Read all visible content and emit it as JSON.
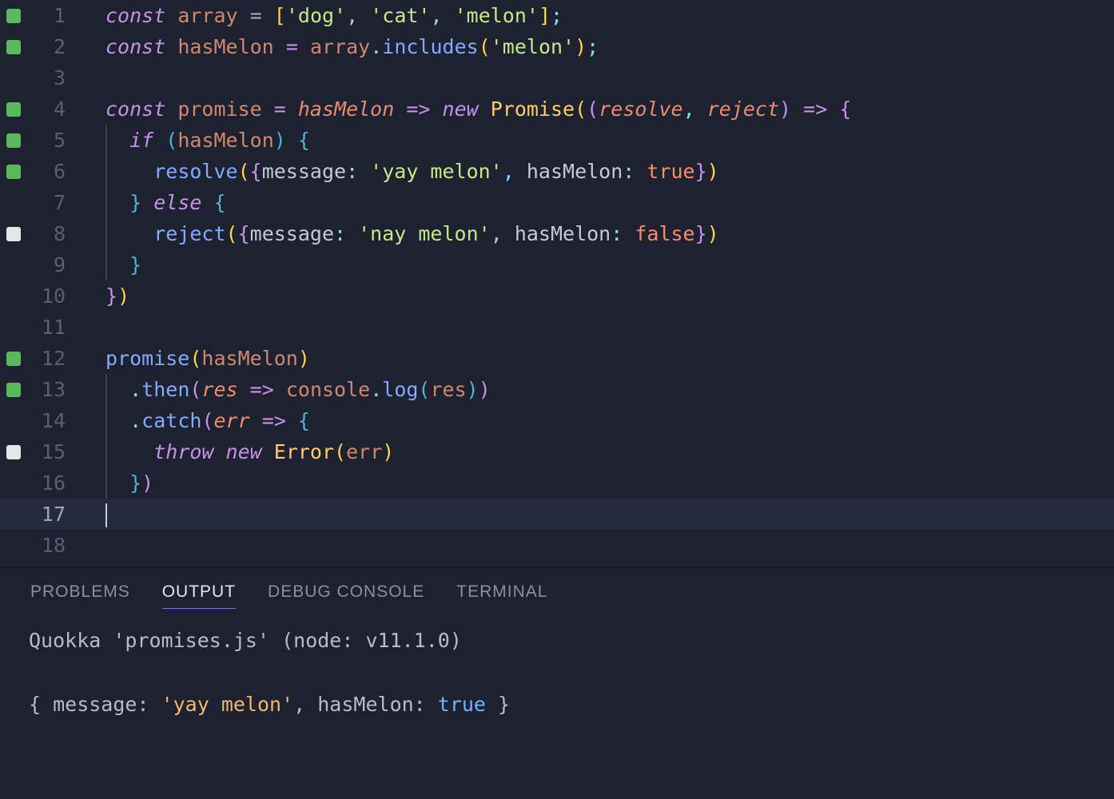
{
  "editor": {
    "lines": [
      {
        "n": 1,
        "mark": "green",
        "tokens": [
          [
            "kw",
            "const"
          ],
          [
            "def",
            " "
          ],
          [
            "var",
            "array"
          ],
          [
            "def",
            " "
          ],
          [
            "op",
            "="
          ],
          [
            "def",
            " "
          ],
          [
            "paren1",
            "["
          ],
          [
            "str",
            "'dog'"
          ],
          [
            "pun",
            ", "
          ],
          [
            "str",
            "'cat'"
          ],
          [
            "pun",
            ", "
          ],
          [
            "str",
            "'melon'"
          ],
          [
            "paren1",
            "]"
          ],
          [
            "pun",
            ";"
          ]
        ]
      },
      {
        "n": 2,
        "mark": "green",
        "tokens": [
          [
            "kw",
            "const"
          ],
          [
            "def",
            " "
          ],
          [
            "var",
            "hasMelon"
          ],
          [
            "def",
            " "
          ],
          [
            "op",
            "="
          ],
          [
            "def",
            " "
          ],
          [
            "var",
            "array"
          ],
          [
            "pun",
            "."
          ],
          [
            "fn",
            "includes"
          ],
          [
            "paren1",
            "("
          ],
          [
            "str",
            "'melon'"
          ],
          [
            "paren1",
            ")"
          ],
          [
            "pun",
            ";"
          ]
        ]
      },
      {
        "n": 3,
        "mark": "",
        "tokens": []
      },
      {
        "n": 4,
        "mark": "green",
        "tokens": [
          [
            "kw",
            "const"
          ],
          [
            "def",
            " "
          ],
          [
            "var",
            "promise"
          ],
          [
            "def",
            " "
          ],
          [
            "op",
            "="
          ],
          [
            "def",
            " "
          ],
          [
            "par",
            "hasMelon"
          ],
          [
            "def",
            " "
          ],
          [
            "op",
            "=>"
          ],
          [
            "def",
            " "
          ],
          [
            "kw",
            "new"
          ],
          [
            "def",
            " "
          ],
          [
            "obj",
            "Promise"
          ],
          [
            "paren1",
            "("
          ],
          [
            "paren2",
            "("
          ],
          [
            "par",
            "resolve"
          ],
          [
            "pun",
            ", "
          ],
          [
            "par",
            "reject"
          ],
          [
            "paren2",
            ")"
          ],
          [
            "def",
            " "
          ],
          [
            "op",
            "=>"
          ],
          [
            "def",
            " "
          ],
          [
            "paren2",
            "{"
          ]
        ]
      },
      {
        "n": 5,
        "mark": "green",
        "indent": 1,
        "tokens": [
          [
            "def",
            "  "
          ],
          [
            "kw",
            "if"
          ],
          [
            "def",
            " "
          ],
          [
            "paren3",
            "("
          ],
          [
            "var",
            "hasMelon"
          ],
          [
            "paren3",
            ")"
          ],
          [
            "def",
            " "
          ],
          [
            "paren3",
            "{"
          ]
        ]
      },
      {
        "n": 6,
        "mark": "green",
        "indent": 1,
        "tokens": [
          [
            "def",
            "    "
          ],
          [
            "fn",
            "resolve"
          ],
          [
            "paren1",
            "("
          ],
          [
            "paren2",
            "{"
          ],
          [
            "prop",
            "message"
          ],
          [
            "pun",
            ": "
          ],
          [
            "str",
            "'yay melon'"
          ],
          [
            "pun",
            ", "
          ],
          [
            "prop",
            "hasMelon"
          ],
          [
            "pun",
            ": "
          ],
          [
            "bool",
            "true"
          ],
          [
            "paren2",
            "}"
          ],
          [
            "paren1",
            ")"
          ]
        ]
      },
      {
        "n": 7,
        "mark": "",
        "indent": 1,
        "tokens": [
          [
            "def",
            "  "
          ],
          [
            "paren3",
            "}"
          ],
          [
            "def",
            " "
          ],
          [
            "kw",
            "else"
          ],
          [
            "def",
            " "
          ],
          [
            "paren3",
            "{"
          ]
        ]
      },
      {
        "n": 8,
        "mark": "white",
        "indent": 1,
        "tokens": [
          [
            "def",
            "    "
          ],
          [
            "fn",
            "reject"
          ],
          [
            "paren1",
            "("
          ],
          [
            "paren2",
            "{"
          ],
          [
            "prop",
            "message"
          ],
          [
            "pun",
            ": "
          ],
          [
            "str",
            "'nay melon'"
          ],
          [
            "pun",
            ", "
          ],
          [
            "prop",
            "hasMelon"
          ],
          [
            "pun",
            ": "
          ],
          [
            "bool",
            "false"
          ],
          [
            "paren2",
            "}"
          ],
          [
            "paren1",
            ")"
          ]
        ]
      },
      {
        "n": 9,
        "mark": "",
        "indent": 1,
        "tokens": [
          [
            "def",
            "  "
          ],
          [
            "paren3",
            "}"
          ]
        ]
      },
      {
        "n": 10,
        "mark": "",
        "tokens": [
          [
            "paren2",
            "}"
          ],
          [
            "paren1",
            ")"
          ]
        ]
      },
      {
        "n": 11,
        "mark": "",
        "tokens": []
      },
      {
        "n": 12,
        "mark": "green",
        "tokens": [
          [
            "fn",
            "promise"
          ],
          [
            "paren1",
            "("
          ],
          [
            "var",
            "hasMelon"
          ],
          [
            "paren1",
            ")"
          ]
        ]
      },
      {
        "n": 13,
        "mark": "green",
        "indent": 1,
        "tokens": [
          [
            "def",
            "  "
          ],
          [
            "pun",
            "."
          ],
          [
            "fn",
            "then"
          ],
          [
            "paren2",
            "("
          ],
          [
            "par",
            "res"
          ],
          [
            "def",
            " "
          ],
          [
            "op",
            "=>"
          ],
          [
            "def",
            " "
          ],
          [
            "var",
            "console"
          ],
          [
            "pun",
            "."
          ],
          [
            "fn",
            "log"
          ],
          [
            "paren3",
            "("
          ],
          [
            "var",
            "res"
          ],
          [
            "paren3",
            ")"
          ],
          [
            "paren2",
            ")"
          ]
        ]
      },
      {
        "n": 14,
        "mark": "",
        "indent": 1,
        "tokens": [
          [
            "def",
            "  "
          ],
          [
            "pun",
            "."
          ],
          [
            "fn",
            "catch"
          ],
          [
            "paren2",
            "("
          ],
          [
            "par",
            "err"
          ],
          [
            "def",
            " "
          ],
          [
            "op",
            "=>"
          ],
          [
            "def",
            " "
          ],
          [
            "paren3",
            "{"
          ]
        ]
      },
      {
        "n": 15,
        "mark": "white",
        "indent": 1,
        "tokens": [
          [
            "def",
            "    "
          ],
          [
            "kw",
            "throw"
          ],
          [
            "def",
            " "
          ],
          [
            "kw",
            "new"
          ],
          [
            "def",
            " "
          ],
          [
            "obj",
            "Error"
          ],
          [
            "paren1",
            "("
          ],
          [
            "var",
            "err"
          ],
          [
            "paren1",
            ")"
          ]
        ]
      },
      {
        "n": 16,
        "mark": "",
        "indent": 1,
        "tokens": [
          [
            "def",
            "  "
          ],
          [
            "paren3",
            "}"
          ],
          [
            "paren2",
            ")"
          ]
        ]
      },
      {
        "n": 17,
        "mark": "",
        "current": true,
        "cursor": true,
        "tokens": []
      },
      {
        "n": 18,
        "mark": "",
        "tokens": []
      }
    ]
  },
  "panel": {
    "tabs": [
      {
        "id": "problems",
        "label": "PROBLEMS",
        "active": false
      },
      {
        "id": "output",
        "label": "OUTPUT",
        "active": true
      },
      {
        "id": "debug",
        "label": "DEBUG CONSOLE",
        "active": false
      },
      {
        "id": "terminal",
        "label": "TERMINAL",
        "active": false
      }
    ],
    "output_lines": [
      [
        [
          "out-def",
          "Quokka '"
        ],
        [
          "out-def",
          "promises.js"
        ],
        [
          "out-def",
          "' (node: v11.1.0)"
        ]
      ],
      [],
      [
        [
          "out-def",
          "{ message: "
        ],
        [
          "out-str",
          "'yay melon'"
        ],
        [
          "out-def",
          ", hasMelon: "
        ],
        [
          "out-bool",
          "true"
        ],
        [
          "out-def",
          " }"
        ]
      ]
    ]
  }
}
